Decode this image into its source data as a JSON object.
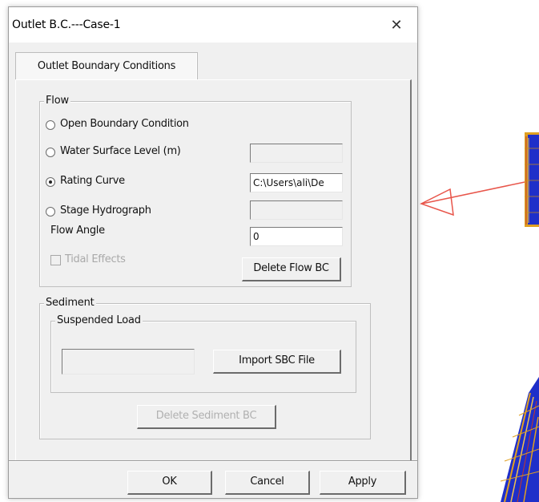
{
  "dialog": {
    "title": "Outlet B.C.---Case-1",
    "close_glyph": "✕",
    "tab_label": "Outlet Boundary Conditions"
  },
  "flow": {
    "group_title": "Flow",
    "options": [
      {
        "label": "Open Boundary Condition",
        "checked": false
      },
      {
        "label": "Water Surface Level (m)",
        "checked": false
      },
      {
        "label": "Rating Curve",
        "checked": true
      },
      {
        "label": "Stage Hydrograph",
        "checked": false
      }
    ],
    "water_surface_value": "",
    "rating_curve_value": "C:\\Users\\ali\\De",
    "stage_hydrograph_value": "",
    "flow_angle_label": "Flow Angle",
    "flow_angle_value": "0",
    "tidal_effects_label": "Tidal Effects",
    "delete_flow_bc_label": "Delete Flow BC"
  },
  "sediment": {
    "group_title": "Sediment",
    "suspended_load_title": "Suspended Load",
    "suspended_load_value": "",
    "import_sbc_label": "Import SBC File",
    "delete_sediment_bc_label": "Delete Sediment BC"
  },
  "buttons": {
    "ok_label": "OK",
    "cancel_label": "Cancel",
    "apply_label": "Apply"
  },
  "colors": {
    "arrow": "#e8554a",
    "mesh_fill": "#1f2fc9",
    "mesh_edge": "#e0a020"
  }
}
